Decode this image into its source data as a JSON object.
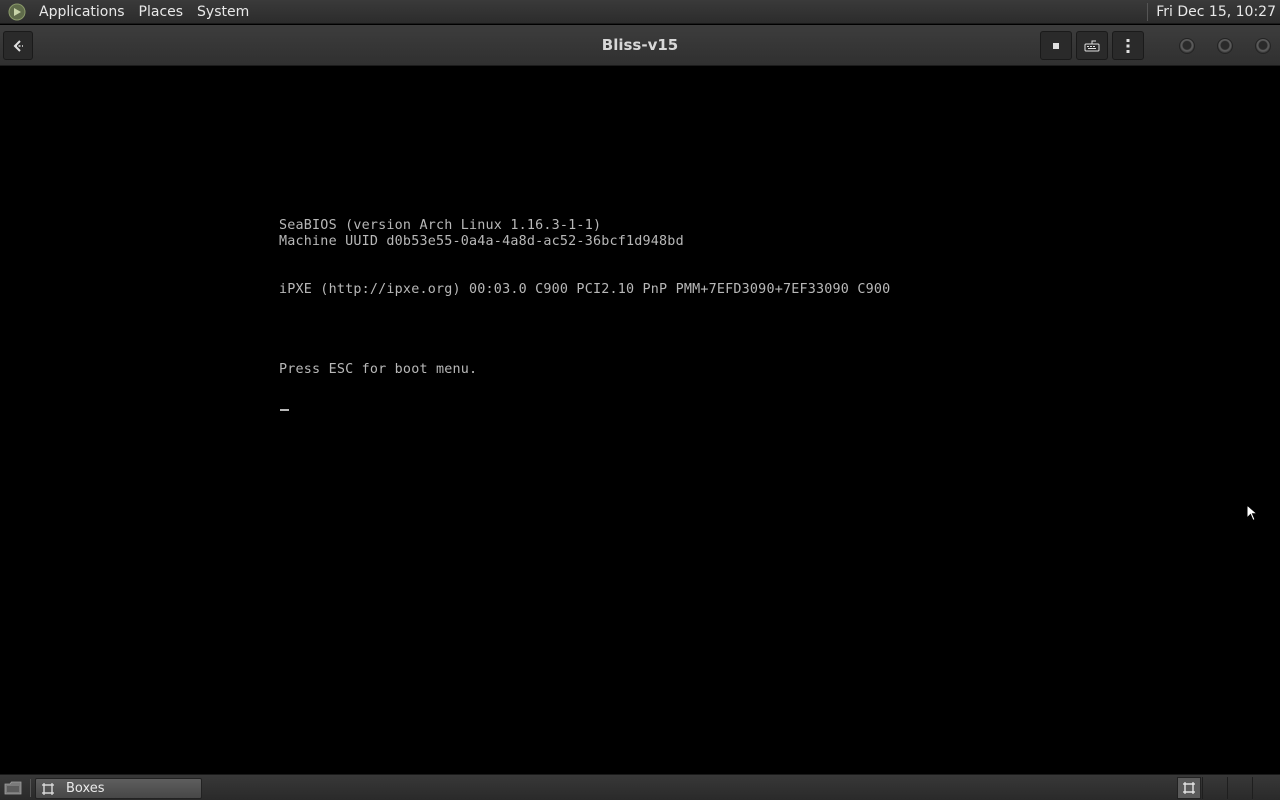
{
  "top_panel": {
    "menus": [
      "Applications",
      "Places",
      "System"
    ],
    "clock": "Fri Dec 15, 10:27"
  },
  "window": {
    "title": "Bliss-v15"
  },
  "vm_screen": {
    "lines": [
      "SeaBIOS (version Arch Linux 1.16.3-1-1)",
      "Machine UUID d0b53e55-0a4a-4a8d-ac52-36bcf1d948bd",
      "iPXE (http://ipxe.org) 00:03.0 C900 PCI2.10 PnP PMM+7EFD3090+7EF33090 C900",
      "Press ESC for boot menu."
    ]
  },
  "taskbar": {
    "task_label": "Boxes"
  }
}
